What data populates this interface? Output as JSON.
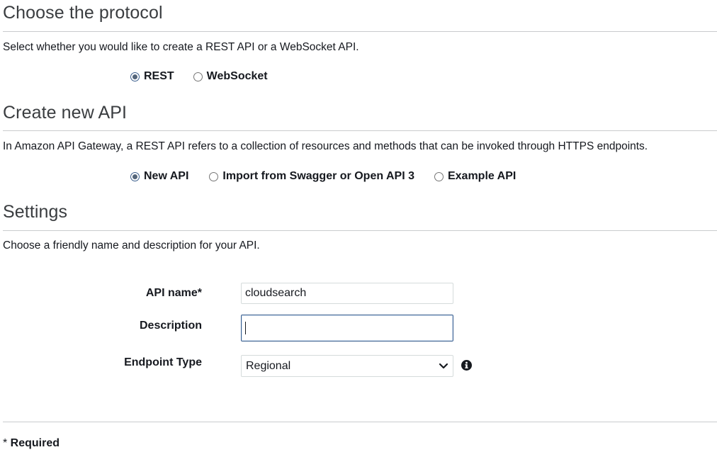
{
  "protocol": {
    "heading": "Choose the protocol",
    "description": "Select whether you would like to create a REST API or a WebSocket API.",
    "options": [
      {
        "label": "REST",
        "checked": true
      },
      {
        "label": "WebSocket",
        "checked": false
      }
    ]
  },
  "create": {
    "heading": "Create new API",
    "description": "In Amazon API Gateway, a REST API refers to a collection of resources and methods that can be invoked through HTTPS endpoints.",
    "options": [
      {
        "label": "New API",
        "checked": true
      },
      {
        "label": "Import from Swagger or Open API 3",
        "checked": false
      },
      {
        "label": "Example API",
        "checked": false
      }
    ]
  },
  "settings": {
    "heading": "Settings",
    "description": "Choose a friendly name and description for your API.",
    "api_name_label": "API name*",
    "api_name_value": "cloudsearch",
    "description_label": "Description",
    "description_value": "",
    "endpoint_label": "Endpoint Type",
    "endpoint_value": "Regional",
    "endpoint_icon": "chevron-down-icon",
    "info_icon": "info-icon"
  },
  "footer": {
    "required_note": "* Required"
  }
}
